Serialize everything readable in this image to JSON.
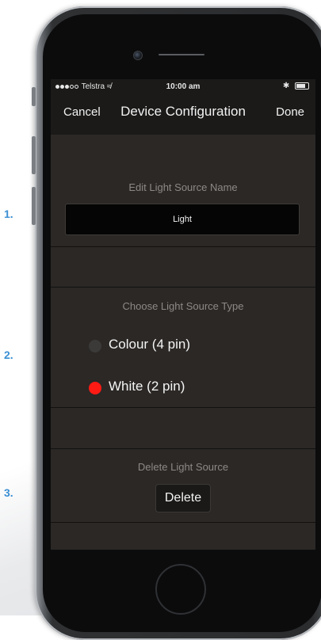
{
  "steps": [
    "1.",
    "2.",
    "3."
  ],
  "status_bar": {
    "carrier": "Telstra",
    "time": "10:00 am",
    "bluetooth": "✱"
  },
  "nav": {
    "cancel": "Cancel",
    "title": "Device Configuration",
    "done": "Done"
  },
  "name_section": {
    "title": "Edit Light Source Name",
    "value": "Light"
  },
  "type_section": {
    "title": "Choose Light Source Type",
    "options": [
      {
        "label": "Colour (4 pin)",
        "selected": false,
        "color": "#3c3a39"
      },
      {
        "label": "White (2 pin)",
        "selected": true,
        "color": "#ff1a14"
      }
    ]
  },
  "delete_section": {
    "title": "Delete Light Source",
    "button": "Delete"
  },
  "colors": {
    "accent": "#3b8fd3",
    "screen_bg": "#2b2826",
    "selected_radio": "#ff1a14"
  }
}
